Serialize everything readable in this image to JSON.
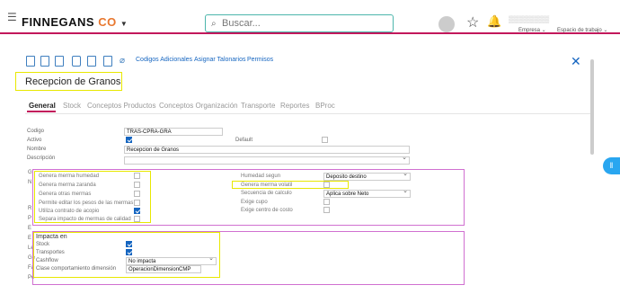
{
  "header": {
    "logo_text": "FINNEGANS",
    "logo_suffix": "CO",
    "search_placeholder": "Buscar...",
    "company_label": "Empresa",
    "workspace_label": "Espacio de trabajo"
  },
  "toolbar": {
    "codigos_adicionales": "Codigos Adicionales",
    "asignar_talonarios": "Asignar Talonarios",
    "permisos": "Permisos"
  },
  "page": {
    "title": "Recepcion de Granos"
  },
  "tabs": [
    "General",
    "Stock",
    "Conceptos Productos",
    "Conceptos Organización",
    "Transporte",
    "Reportes",
    "BProc"
  ],
  "form": {
    "codigo_label": "Codigo",
    "codigo_value": "TRAS-CPRA-GRA",
    "activo_label": "Activo",
    "default_label": "Default",
    "nombre_label": "Nombre",
    "nombre_value": "Recepcion de Granos",
    "descripcion_label": "Descripción"
  },
  "left_options": {
    "genera_merma_humedad": "Genera merma humedad",
    "genera_merma_zaranda": "Genera merma zaranda",
    "genera_otras_mermas": "Genera otras mermas",
    "permite_editar_pesos": "Permite editar los pesos de las mermas",
    "utiliza_contrato": "Utiliza contrato de acopio",
    "separa_impacto": "Separa impacto de mermas de calidad"
  },
  "right_options": {
    "humedad_segun_label": "Humedad segun",
    "humedad_segun_value": "Deposito destino",
    "genera_merma_volatil": "Genera merma volatil",
    "secuencia_calculo_label": "Secuencia de calculo",
    "secuencia_calculo_value": "Aplica sobre Neto",
    "exige_cupo": "Exige cupo",
    "exige_centro_costo": "Exige centro de costo"
  },
  "impacta": {
    "title": "Impacta en",
    "stock": "Stock",
    "transportes": "Transportes",
    "cashflow_label": "Cashflow",
    "cashflow_value": "No impacta",
    "clase_label": "Clase comportamiento dimensión",
    "clase_value": "OperacionDimensionCMP"
  },
  "left_cut_labels": [
    "G",
    "N",
    "R",
    "P",
    "E",
    "E",
    "Le",
    "Ge",
    "Fa",
    "Pe"
  ],
  "colors": {
    "brand_accent": "#c2185b",
    "logo_co": "#e8772e",
    "link": "#1565c0",
    "highlight_yellow": "#e8e800",
    "highlight_pink": "#d070d0"
  }
}
